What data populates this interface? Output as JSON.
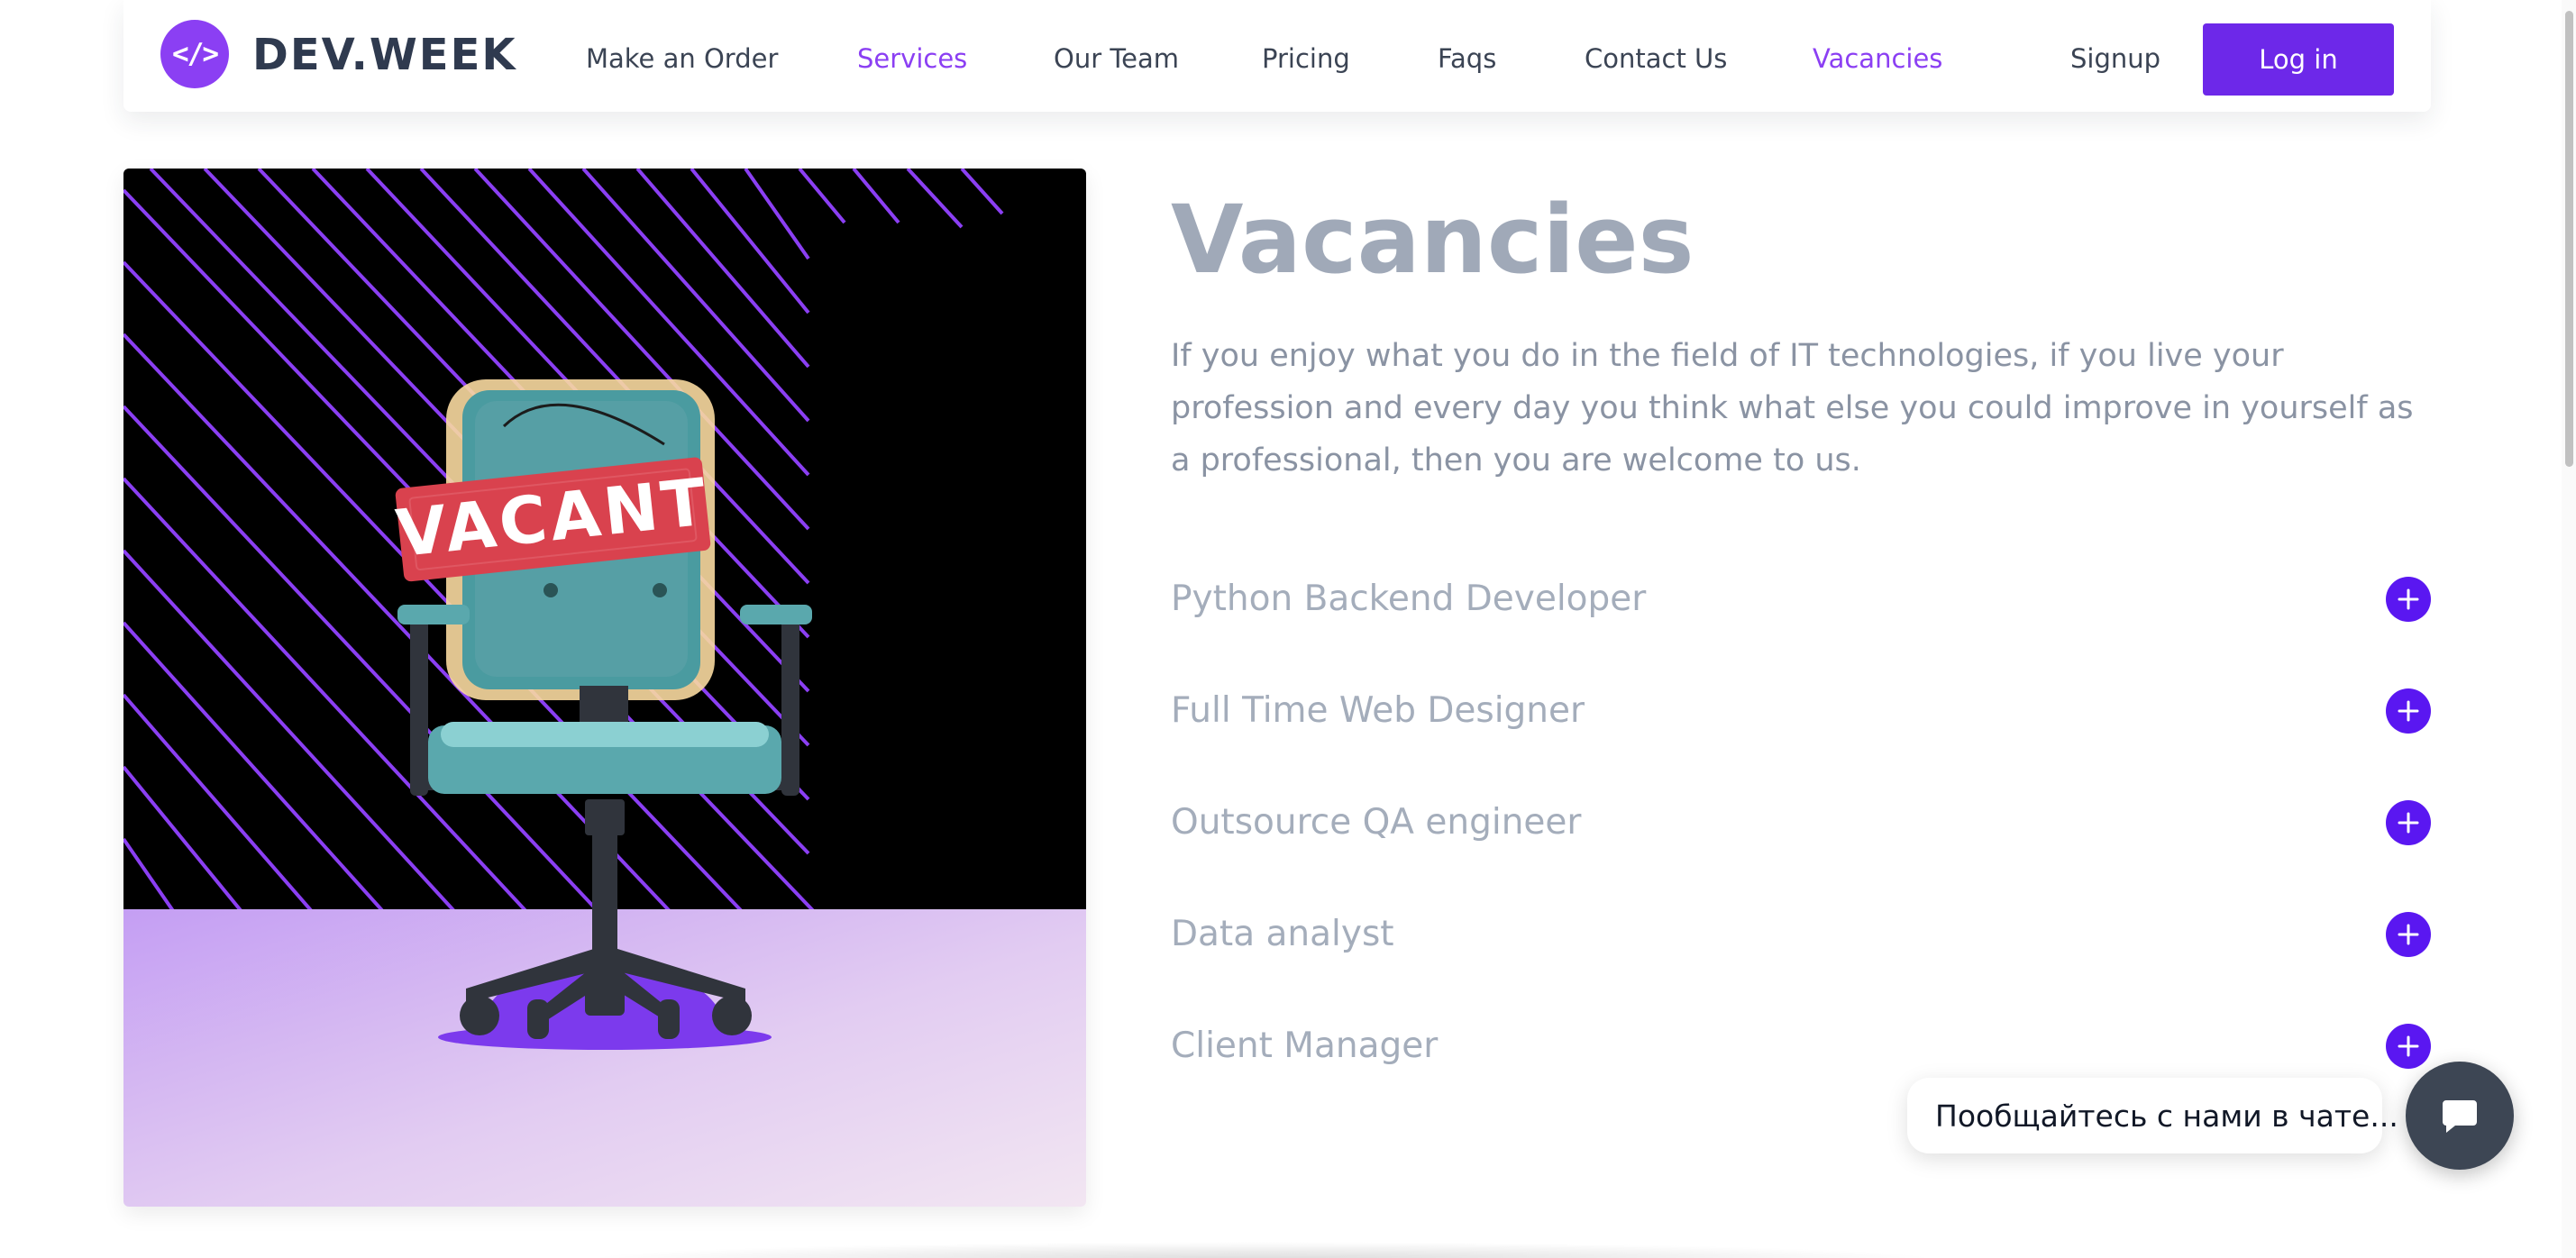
{
  "brand": {
    "logo_glyph": "</>",
    "name": "DEV.WEEK",
    "accent_color": "#8b3ff3"
  },
  "nav": {
    "items": [
      {
        "label": "Make an Order",
        "active": false
      },
      {
        "label": "Services",
        "active": true
      },
      {
        "label": "Our Team",
        "active": false
      },
      {
        "label": "Pricing",
        "active": false
      },
      {
        "label": "Faqs",
        "active": false
      },
      {
        "label": "Contact Us",
        "active": false
      },
      {
        "label": "Vacancies",
        "active": true
      }
    ],
    "signup": "Signup",
    "login": "Log in",
    "login_color": "#6d28e9"
  },
  "hero": {
    "sign_text": "VACANT"
  },
  "page": {
    "title": "Vacancies",
    "intro": "If you enjoy what you do in the field of IT technologies, if you live your profession and every day you think what else you could improve in yourself as a professional, then you are welcome to us."
  },
  "vacancies": [
    {
      "title": "Python Backend Developer",
      "icon": "plus-icon"
    },
    {
      "title": "Full Time Web Designer",
      "icon": "plus-icon"
    },
    {
      "title": "Outsource QA engineer",
      "icon": "plus-icon"
    },
    {
      "title": "Data analyst",
      "icon": "plus-icon"
    },
    {
      "title": "Client Manager",
      "icon": "plus-icon"
    }
  ],
  "chat": {
    "prompt": "Пообщайтесь с нами в чате...",
    "icon": "chat-icon"
  }
}
